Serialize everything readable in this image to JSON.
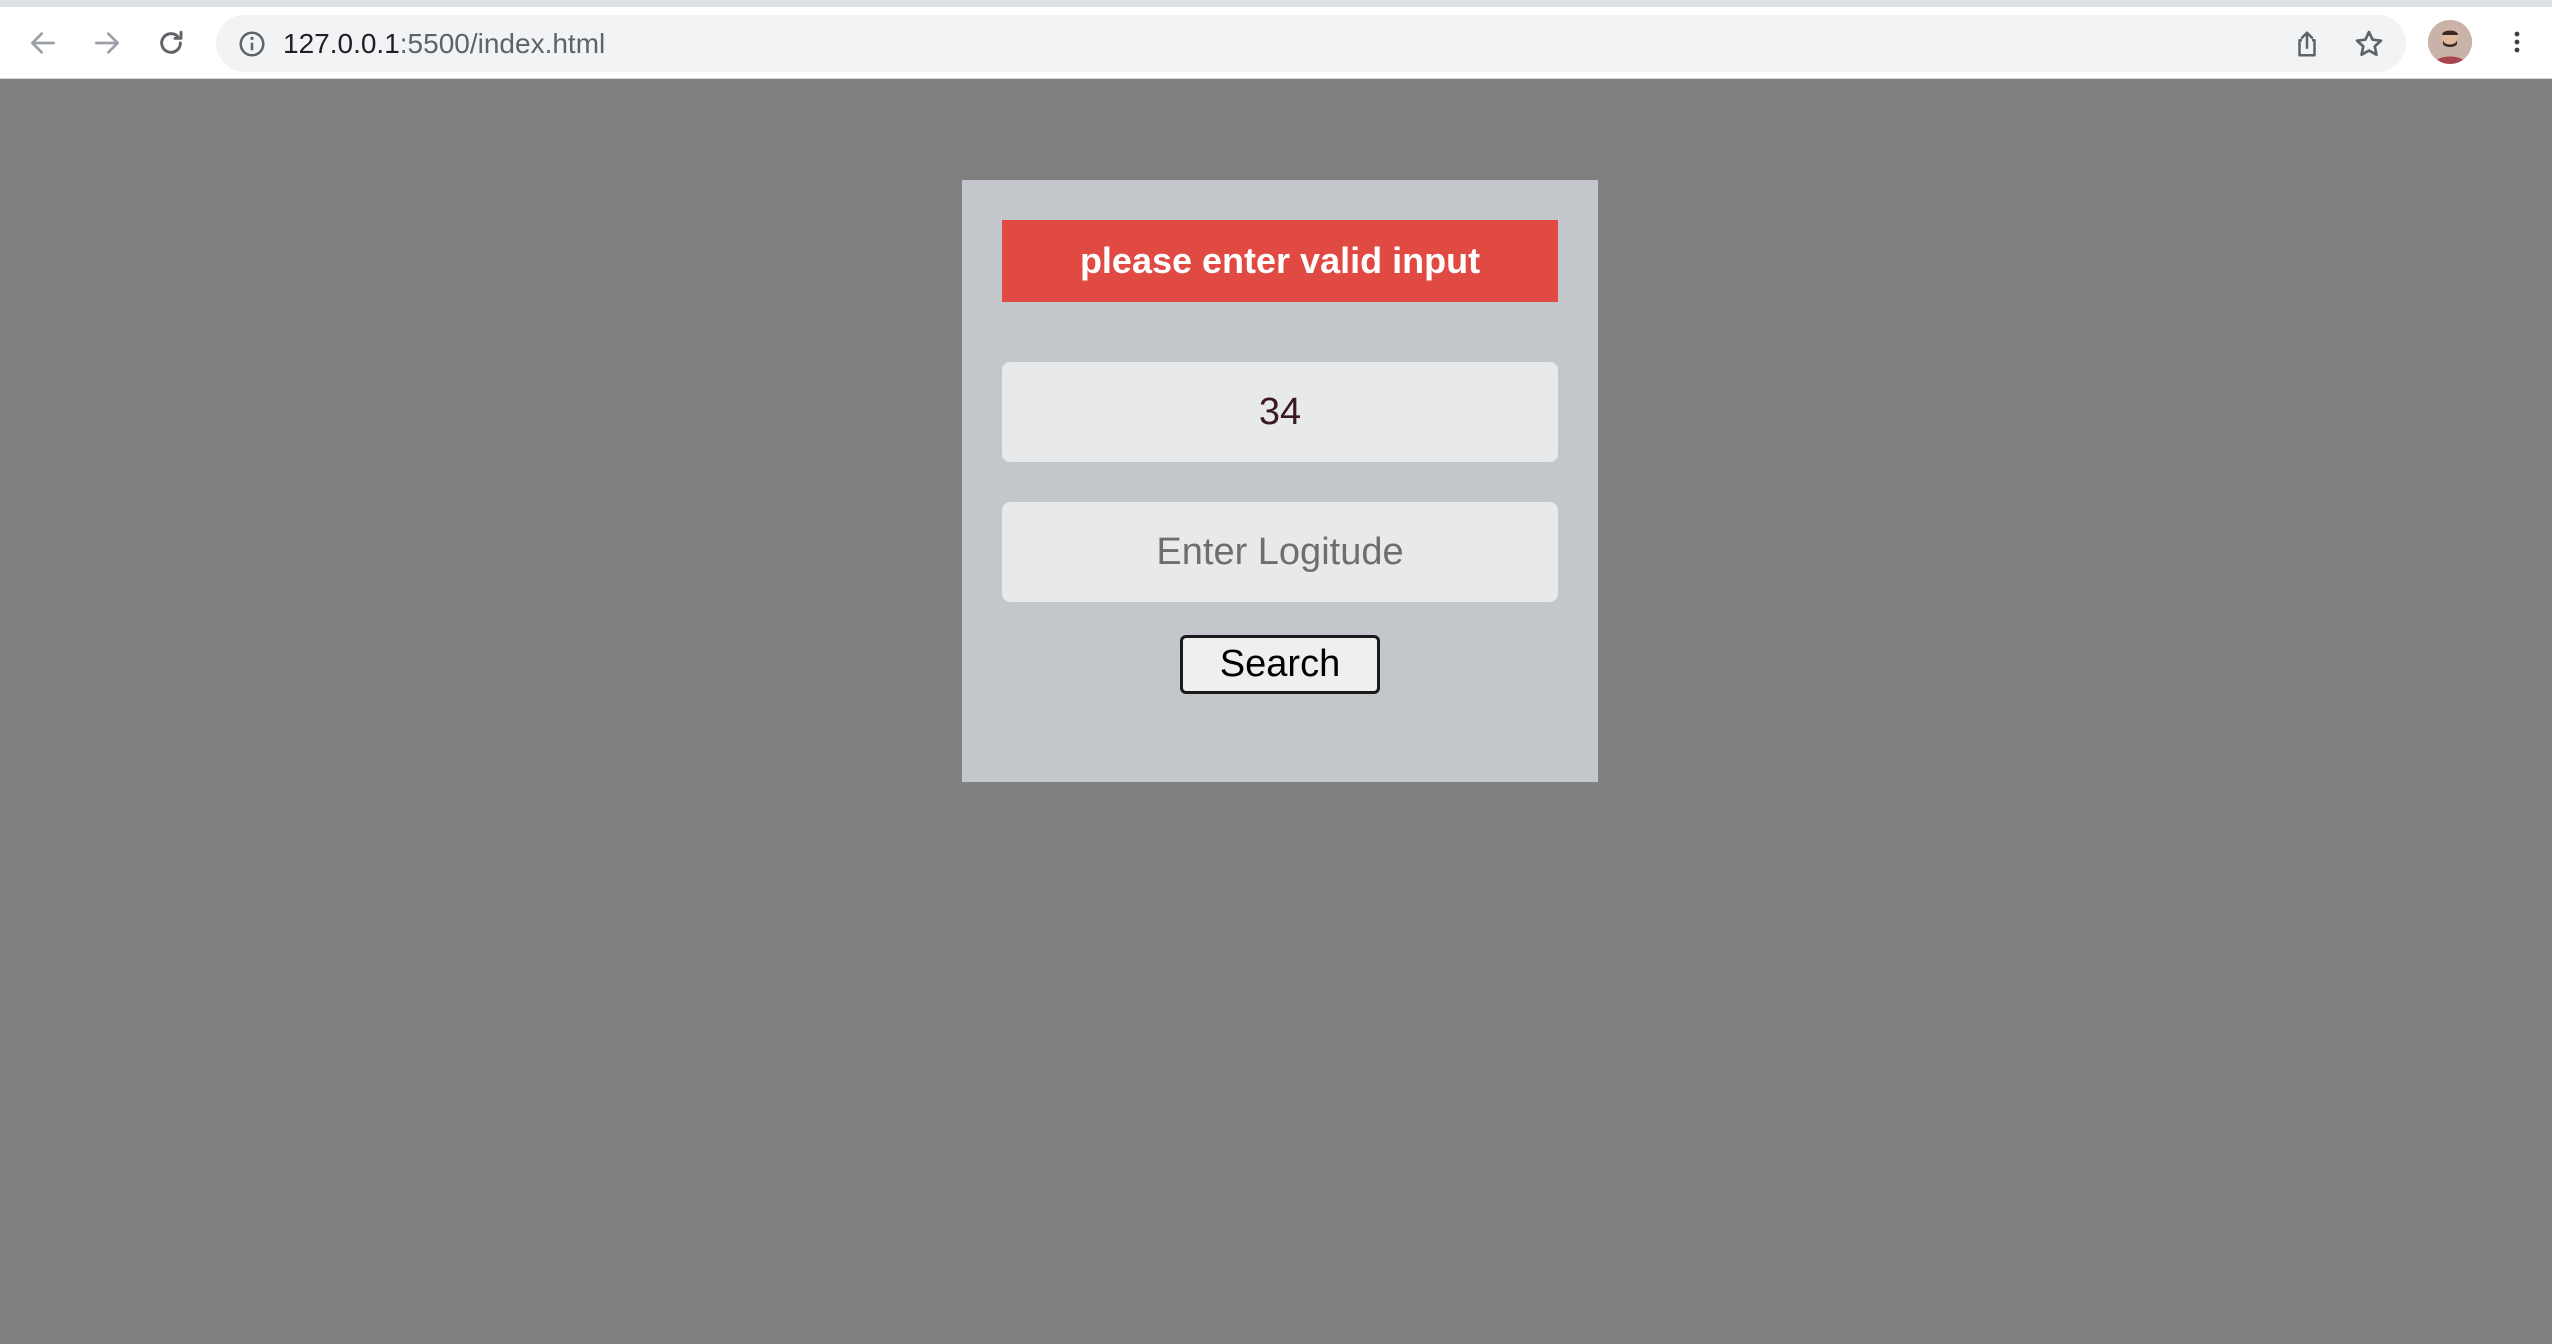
{
  "browser": {
    "url_host": "127.0.0.1",
    "url_rest": ":5500/index.html",
    "icons": [
      "back-arrow-icon",
      "forward-arrow-icon",
      "reload-icon",
      "info-icon",
      "share-icon",
      "star-icon",
      "avatar",
      "kebab-menu-icon"
    ]
  },
  "page": {
    "error_message": "please enter valid input",
    "latitude_value": "34",
    "longitude_placeholder": "Enter Logitude",
    "longitude_value": "",
    "search_label": "Search"
  },
  "colors": {
    "page_background": "#808080",
    "card_background": "#c3c6ca",
    "error_background": "#e04a43",
    "input_background": "#e8e9eb"
  }
}
